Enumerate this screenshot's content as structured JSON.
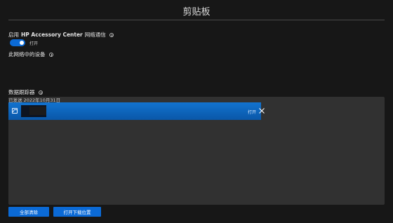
{
  "header": {
    "title": "剪贴板"
  },
  "enable_comms": {
    "label_prefix": "启用",
    "label_brand": "HP Accessory Center",
    "label_suffix": "网络通信"
  },
  "toggle": {
    "state_label": "打开",
    "on": true,
    "accent": "#0b6ad6"
  },
  "devices": {
    "label": "此网络中的设备"
  },
  "tracker": {
    "label": "数据跟踪器",
    "sent_date": "已发送 2022年10月31日"
  },
  "notification": {
    "open_label": "打开",
    "icon": "image-icon",
    "close_icon": "close-icon"
  },
  "footer": {
    "clear_all_label": "全部清除",
    "open_download_label": "打开下载位置"
  },
  "colors": {
    "background": "#171717",
    "panel": "#313131",
    "accent": "#0b6ad6"
  }
}
